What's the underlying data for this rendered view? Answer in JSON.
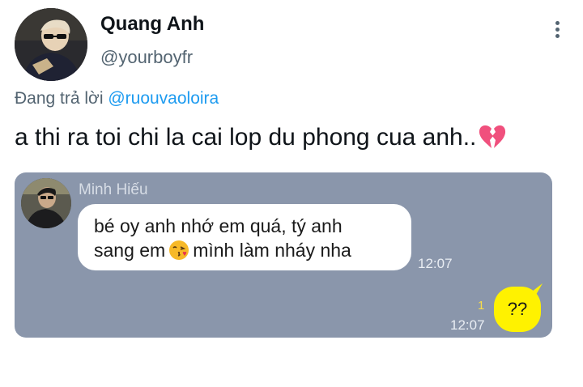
{
  "author": {
    "name": "Quang Anh",
    "handle": "@yourboyfr"
  },
  "reply": {
    "prefix": "Đang trả lời",
    "mention": "@ruouvaoloira"
  },
  "tweet_text": "a thi ra toi chi la cai lop du phong cua anh..",
  "embedded_chat": {
    "contact_name": "Minh Hiếu",
    "incoming": {
      "line1": "bé oy anh nhớ em quá, tý anh",
      "line2_before_emoji": "sang em",
      "line2_after_emoji": "mình làm nháy nha",
      "time": "12:07"
    },
    "outgoing": {
      "text": "??",
      "read_count": "1",
      "time": "12:07"
    }
  },
  "icons": {
    "more": "more-vertical-icon",
    "broken_heart": "broken-heart-icon",
    "kiss_face": "kissing-face-icon"
  },
  "colors": {
    "mention": "#1d9bf0",
    "chat_background": "#8a96ab",
    "outgoing_bubble": "#fff200",
    "broken_heart": "#f0507d"
  }
}
